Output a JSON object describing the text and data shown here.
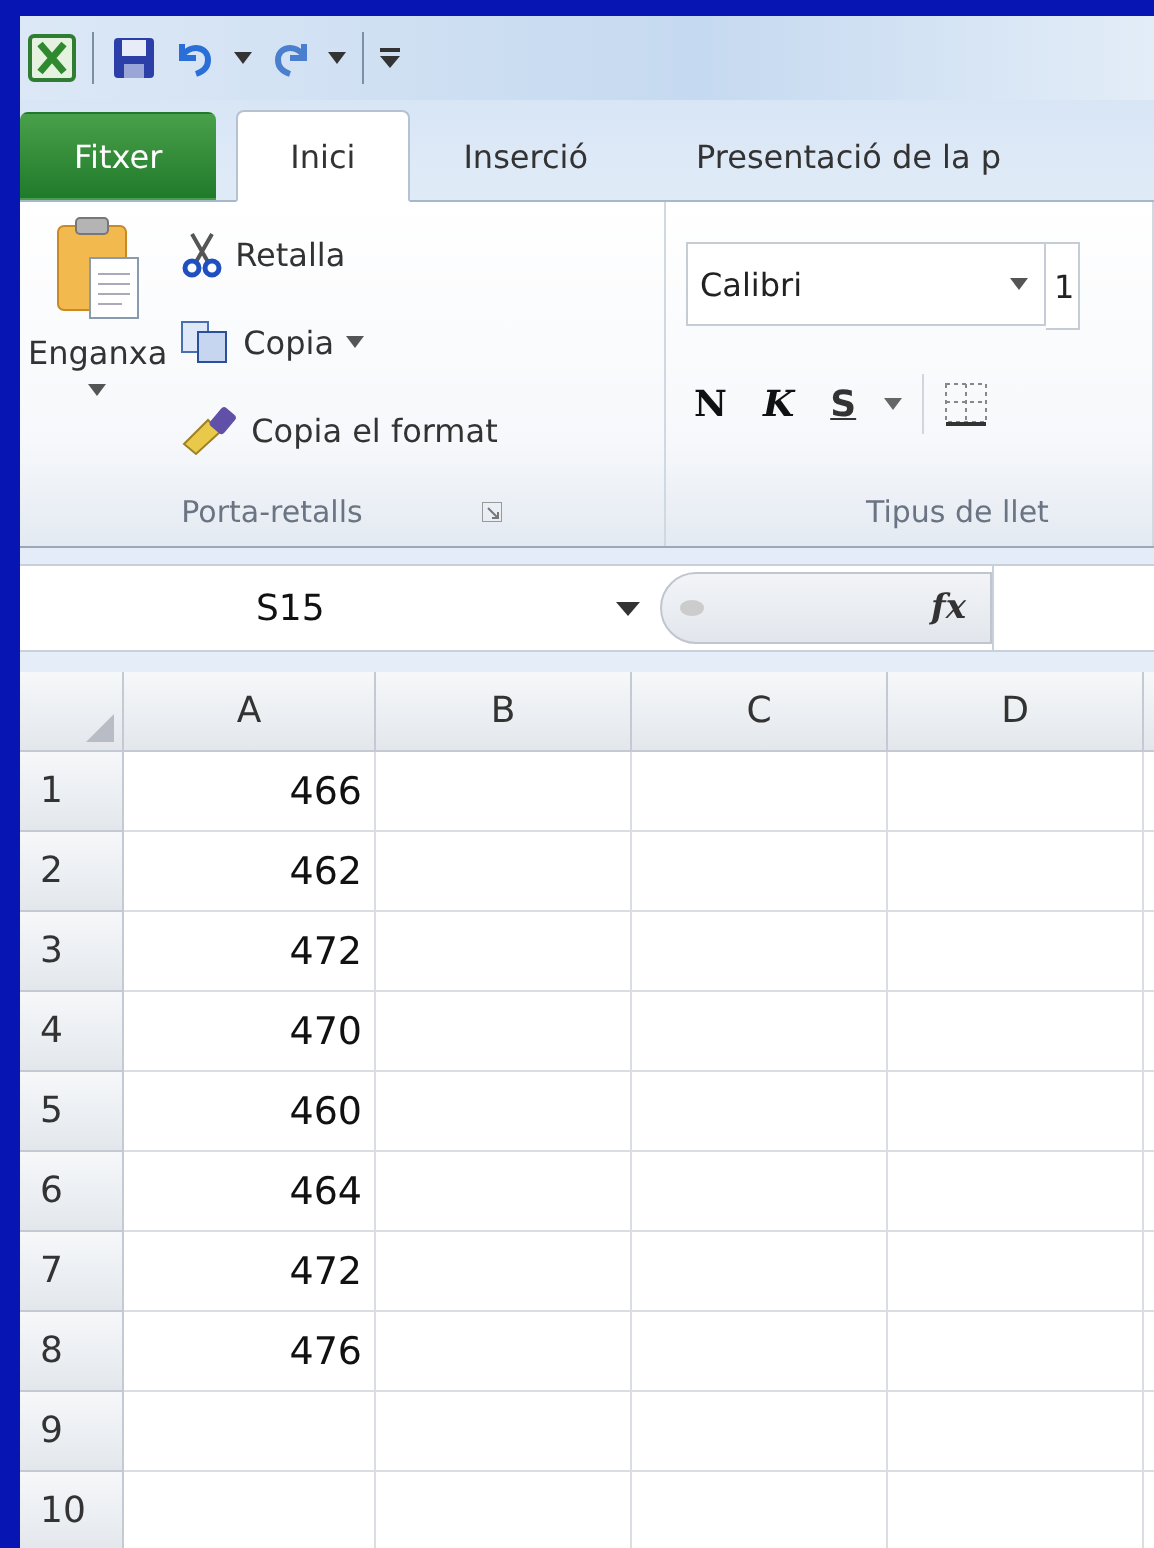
{
  "tabs": [
    {
      "label": "Fitxer",
      "kind": "file",
      "selected": false
    },
    {
      "label": "Inici",
      "kind": "tab",
      "selected": true
    },
    {
      "label": "Inserció",
      "kind": "tab",
      "selected": false
    },
    {
      "label": "Presentació de la p",
      "kind": "tab",
      "selected": false
    }
  ],
  "clipboard": {
    "paste": "Enganxa",
    "cut": "Retalla",
    "copy": "Copia",
    "format_painter": "Copia el format",
    "label": "Porta-retalls"
  },
  "font": {
    "family": "Calibri",
    "size": "1",
    "bold": "N",
    "italic": "K",
    "underline": "S",
    "label": "Tipus de llet"
  },
  "formula_bar": {
    "name_box": "S15",
    "function_label": "fx"
  },
  "sheet": {
    "columns": [
      "A",
      "B",
      "C",
      "D"
    ],
    "rows": [
      {
        "header": "1",
        "values": [
          "466"
        ]
      },
      {
        "header": "2",
        "values": [
          "462"
        ]
      },
      {
        "header": "3",
        "values": [
          "472"
        ]
      },
      {
        "header": "4",
        "values": [
          "470"
        ]
      },
      {
        "header": "5",
        "values": [
          "460"
        ]
      },
      {
        "header": "6",
        "values": [
          "464"
        ]
      },
      {
        "header": "7",
        "values": [
          "472"
        ]
      },
      {
        "header": "8",
        "values": [
          "476"
        ]
      },
      {
        "header": "9"
      },
      {
        "header": "10"
      }
    ]
  }
}
